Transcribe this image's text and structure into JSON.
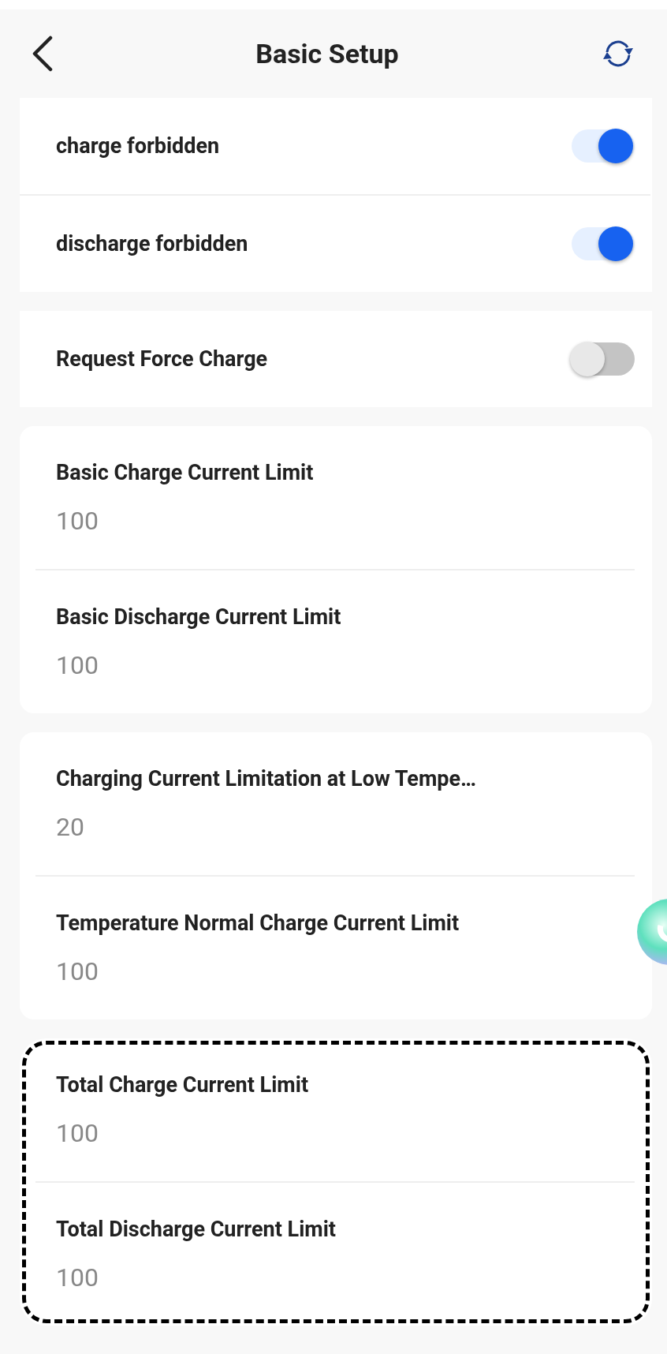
{
  "header": {
    "title": "Basic Setup"
  },
  "groups": [
    {
      "highlighted": false,
      "items": [
        {
          "kind": "switch",
          "label": "charge forbidden",
          "on": true
        },
        {
          "kind": "switch",
          "label": "discharge forbidden",
          "on": true
        }
      ]
    },
    {
      "highlighted": false,
      "items": [
        {
          "kind": "switch",
          "label": "Request Force Charge",
          "on": false
        }
      ]
    },
    {
      "highlighted": false,
      "items": [
        {
          "kind": "value",
          "label": "Basic Charge Current Limit",
          "value": "100"
        },
        {
          "kind": "value",
          "label": "Basic Discharge Current Limit",
          "value": "100"
        }
      ]
    },
    {
      "highlighted": false,
      "items": [
        {
          "kind": "value",
          "label": "Charging Current Limitation at Low Tempe…",
          "value": "20"
        },
        {
          "kind": "value",
          "label": "Temperature Normal Charge Current Limit",
          "value": "100"
        }
      ]
    },
    {
      "highlighted": true,
      "items": [
        {
          "kind": "value",
          "label": "Total Charge Current Limit",
          "value": "100"
        },
        {
          "kind": "value",
          "label": "Total Discharge Current Limit",
          "value": "100"
        }
      ]
    }
  ]
}
